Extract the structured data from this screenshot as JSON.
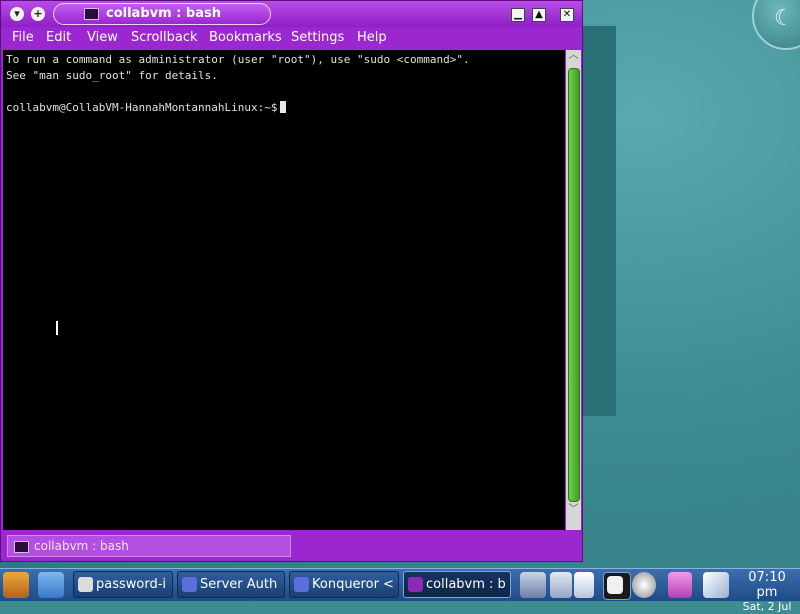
{
  "window": {
    "title": "collabvm : bash",
    "minimize_glyph": "▾",
    "sticky_glyph": "+",
    "win_min": "▁",
    "win_max": "▲",
    "win_close": "✕"
  },
  "menu": [
    "File",
    "Edit",
    "View",
    "Scrollback",
    "Bookmarks",
    "Settings",
    "Help"
  ],
  "terminal": {
    "line1": "To run a command as administrator (user \"root\"), use \"sudo <command>\".",
    "line2": "See \"man sudo_root\" for details.",
    "prompt": "collabvm@CollabVM-HannahMontannahLinux:~$"
  },
  "scroll": {
    "up": "︿",
    "down": "﹀"
  },
  "tab": {
    "label": "collabvm : bash"
  },
  "taskbar": {
    "tasks": [
      {
        "label": "password-i",
        "icon_color": "#dcdcdc"
      },
      {
        "label": "Server Auth",
        "icon_color": "#5c6fd8"
      },
      {
        "label": "Konqueror <",
        "icon_color": "#5c6fd8"
      },
      {
        "label": "collabvm : b",
        "icon_color": "#8a2bb8"
      }
    ],
    "clock_time": "07:10 pm",
    "clock_date": "Sat, 2 Jul"
  },
  "colors": {
    "titlebar": "#9a27d0",
    "terminal_bg": "#000000",
    "scrollbar_thumb": "#4fb52a",
    "taskbar": "#2a5894"
  }
}
